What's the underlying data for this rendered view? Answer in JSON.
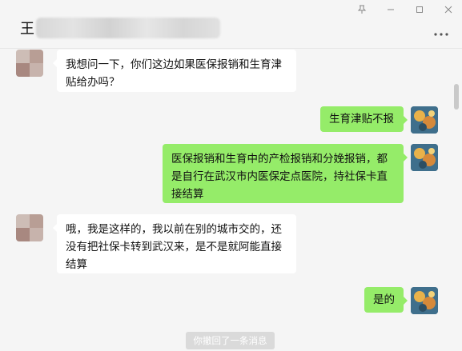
{
  "header": {
    "title_char": "王",
    "more_icon": "more-horizontal-icon",
    "window_icons": [
      "pin-icon",
      "minimize-icon",
      "maximize-icon",
      "close-icon"
    ]
  },
  "messages": [
    {
      "side": "in",
      "text_lines": [
        "我想问一下，你们这边如果医保报销和生育津",
        "贴给办吗？"
      ]
    },
    {
      "side": "out",
      "text_lines": [
        "生育津贴不报"
      ]
    },
    {
      "side": "out",
      "text_lines": [
        "医保报销和生育中的产检报销和分娩报销，都",
        "是自行在武汉市内医保定点医院，持社保卡直",
        "接结算"
      ]
    },
    {
      "side": "in",
      "text_lines": [
        "哦，我是这样的，我以前在别的城市交的，还",
        "没有把社保卡转到武汉来，是不是就阿能直接",
        "结算"
      ]
    },
    {
      "side": "out",
      "text_lines": [
        "是的"
      ]
    }
  ],
  "system_tip": "你撤回了一条消息",
  "colors": {
    "background": "#f5f5f5",
    "incoming_bubble": "#ffffff",
    "outgoing_bubble": "#95ec69"
  }
}
